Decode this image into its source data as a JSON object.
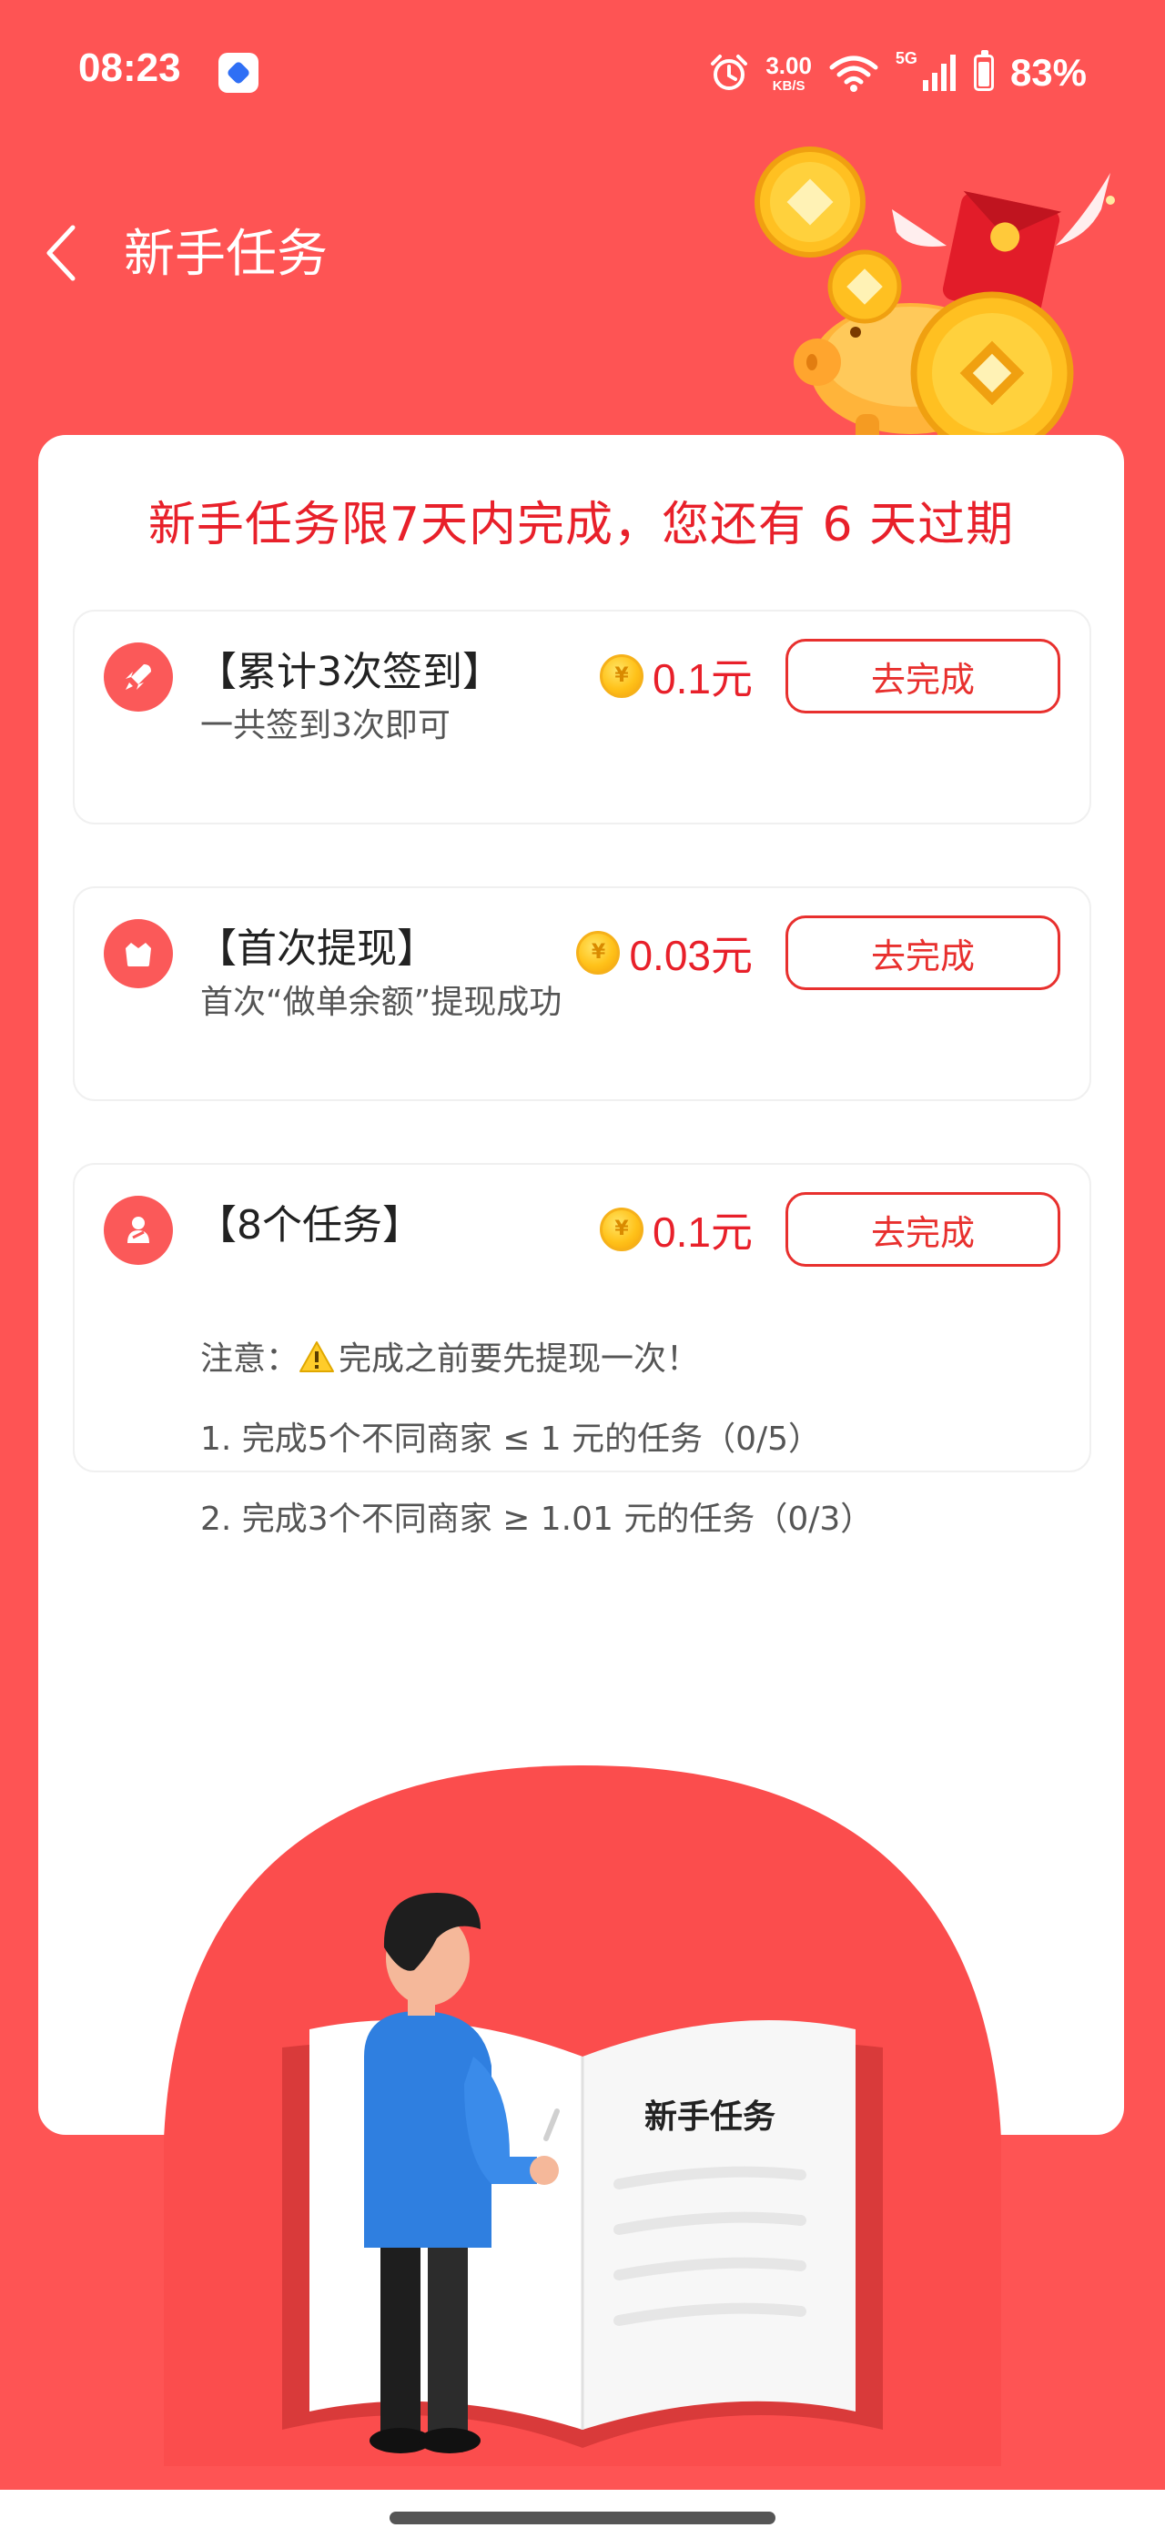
{
  "status_bar": {
    "time": "08:23",
    "speed_value": "3.00",
    "speed_unit": "KB/S",
    "network": "5G",
    "battery": "83%"
  },
  "header": {
    "title": "新手任务"
  },
  "deadline_notice": "新手任务限7天内完成，您还有 6 天过期",
  "tasks": [
    {
      "title": "【累计3次签到】",
      "description": "一共签到3次即可",
      "reward": "0.1元",
      "button": "去完成",
      "icon": "rocket-icon"
    },
    {
      "title": "【首次提现】",
      "description": "首次“做单余额”提现成功",
      "reward": "0.03元",
      "button": "去完成",
      "icon": "wallet-icon"
    },
    {
      "title": "【8个任务】",
      "note_prefix": "注意：",
      "note_text": "完成之前要先提现一次！",
      "line1": "1. 完成5个不同商家 ≤ 1 元的任务（0/5）",
      "line2": "2. 完成3个不同商家 ≥ 1.01 元的任务（0/3）",
      "reward": "0.1元",
      "button": "去完成",
      "icon": "task-icon"
    }
  ],
  "illustration": {
    "book_title": "新手任务"
  },
  "colors": {
    "background": "#fe5454",
    "accent": "#e8202a",
    "coin": "#ffc21a"
  }
}
